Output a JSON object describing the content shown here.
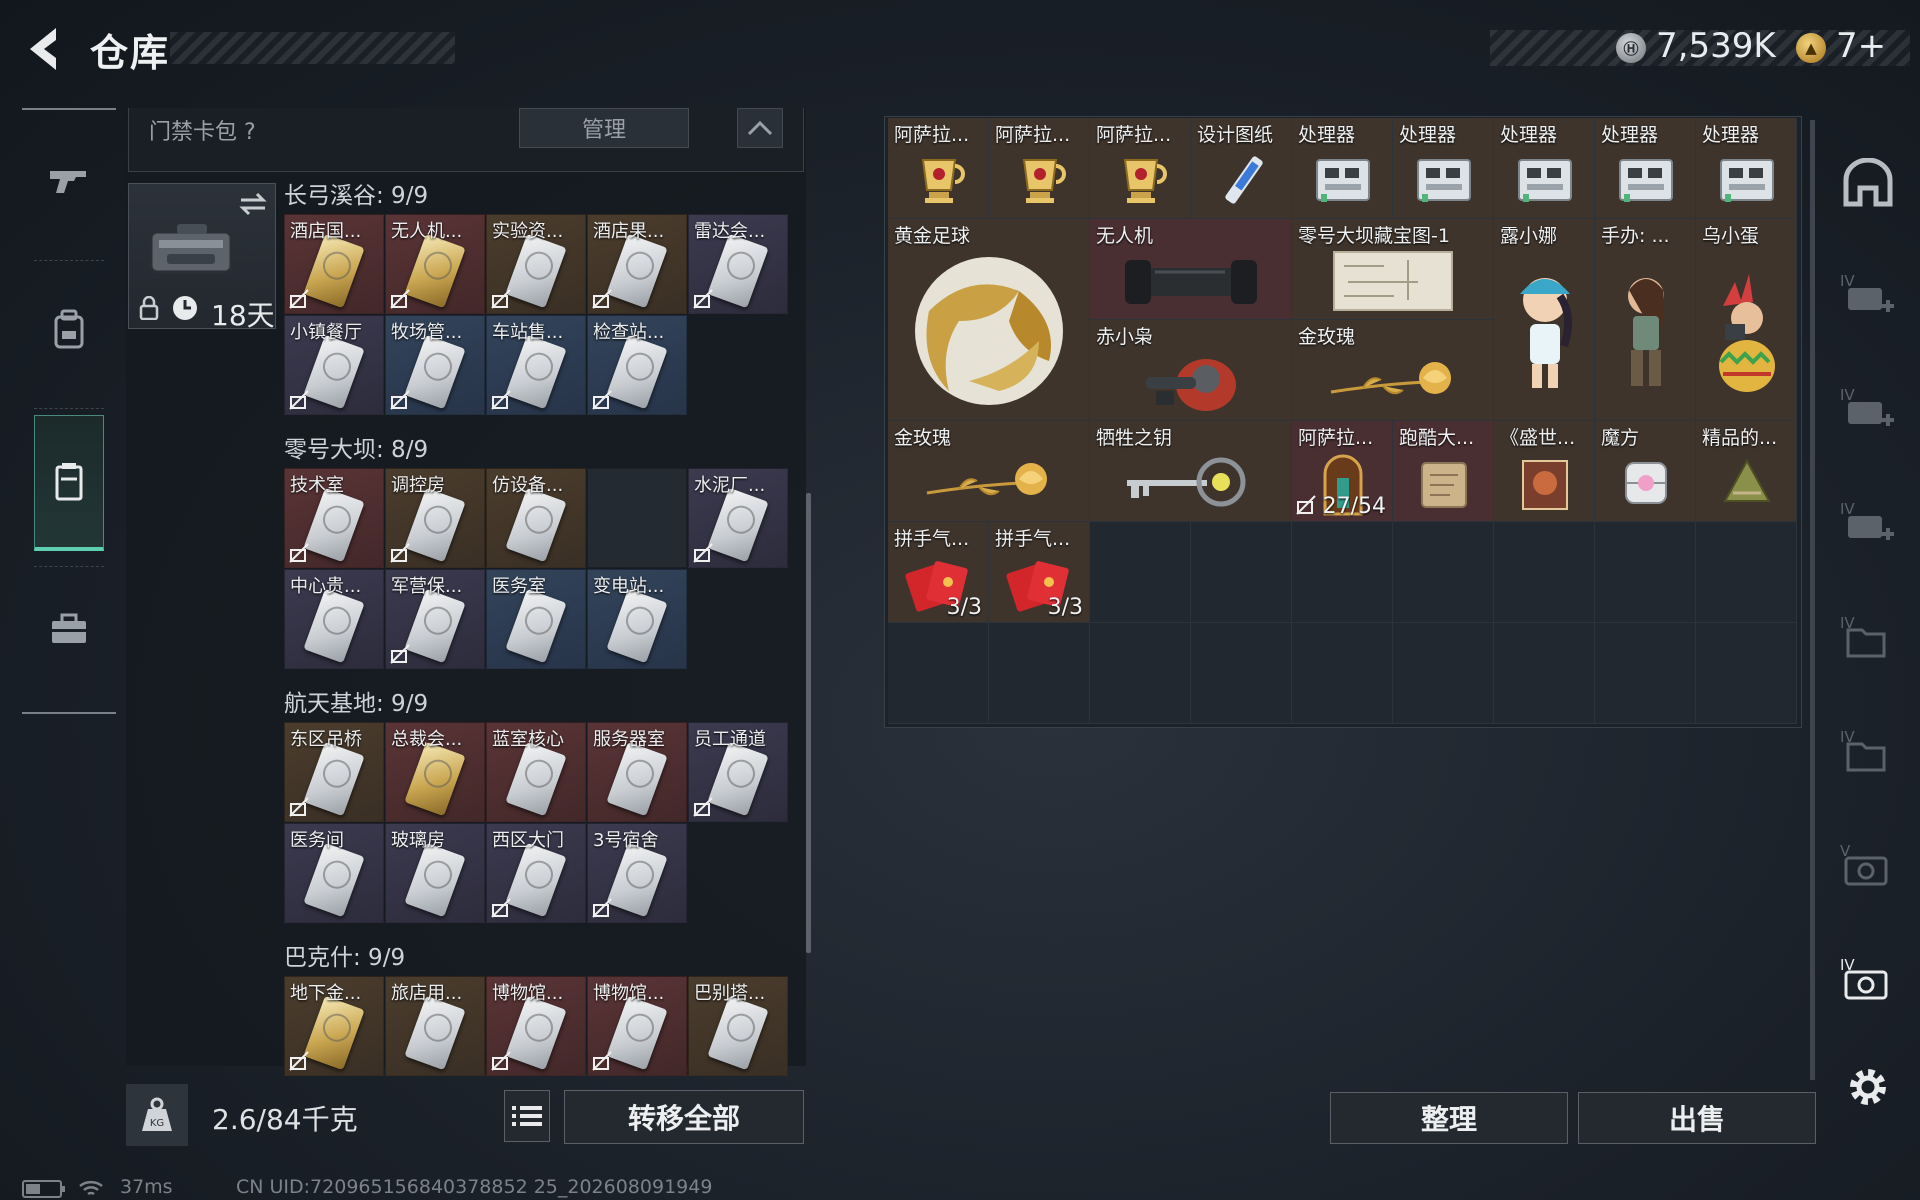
{
  "header": {
    "title": "仓库"
  },
  "currency": {
    "silver": "7,539K",
    "gold": "7+"
  },
  "card_panel": {
    "title": "门禁卡包",
    "help": "?",
    "manage": "管理",
    "pack_duration": "18天",
    "sections": [
      {
        "title": "长弓溪谷: 9/9",
        "cells": [
          {
            "label": "酒店国...",
            "color": "red",
            "card": "gold",
            "locked": true
          },
          {
            "label": "无人机...",
            "color": "red",
            "card": "gold",
            "locked": true
          },
          {
            "label": "实验资...",
            "color": "gold",
            "card": "white",
            "locked": true
          },
          {
            "label": "酒店果...",
            "color": "gold",
            "card": "white",
            "locked": true
          },
          {
            "label": "雷达会...",
            "color": "purple",
            "card": "white",
            "locked": true
          },
          {
            "label": "小镇餐厅",
            "color": "purple",
            "card": "white",
            "locked": true
          },
          {
            "label": "牧场管...",
            "color": "blue",
            "card": "white",
            "locked": true
          },
          {
            "label": "车站售...",
            "color": "blue",
            "card": "white",
            "locked": true
          },
          {
            "label": "检查站...",
            "color": "blue",
            "card": "white",
            "locked": true
          }
        ]
      },
      {
        "title": "零号大坝: 8/9",
        "cells": [
          {
            "label": "技术室",
            "color": "red",
            "card": "white",
            "locked": true
          },
          {
            "label": "调控房",
            "color": "gold",
            "card": "white",
            "locked": true
          },
          {
            "label": "仿设备...",
            "color": "gold",
            "card": "white",
            "locked": false
          },
          {
            "label": "",
            "color": "empty",
            "card": "none",
            "locked": false
          },
          {
            "label": "水泥厂...",
            "color": "purple",
            "card": "white",
            "locked": true
          },
          {
            "label": "中心贵...",
            "color": "purple",
            "card": "white",
            "locked": false
          },
          {
            "label": "军营保...",
            "color": "purple",
            "card": "white",
            "locked": true
          },
          {
            "label": "医务室",
            "color": "blue",
            "card": "white",
            "locked": false
          },
          {
            "label": "变电站...",
            "color": "blue",
            "card": "white",
            "locked": false
          }
        ]
      },
      {
        "title": "航天基地: 9/9",
        "cells": [
          {
            "label": "东区吊桥",
            "color": "gold",
            "card": "white",
            "locked": true
          },
          {
            "label": "总裁会...",
            "color": "red",
            "card": "gold",
            "locked": false
          },
          {
            "label": "蓝室核心",
            "color": "red",
            "card": "white",
            "locked": false
          },
          {
            "label": "服务器室",
            "color": "red",
            "card": "white",
            "locked": false
          },
          {
            "label": "员工通道",
            "color": "purple",
            "card": "white",
            "locked": true
          },
          {
            "label": "医务间",
            "color": "purple",
            "card": "white",
            "locked": false
          },
          {
            "label": "玻璃房",
            "color": "purple",
            "card": "white",
            "locked": false
          },
          {
            "label": "西区大门",
            "color": "purple",
            "card": "white",
            "locked": true
          },
          {
            "label": "3号宿舍",
            "color": "purple",
            "card": "white",
            "locked": true
          }
        ]
      },
      {
        "title": "巴克什: 9/9",
        "cells": [
          {
            "label": "地下金...",
            "color": "gold",
            "card": "gold",
            "locked": true
          },
          {
            "label": "旅店用...",
            "color": "gold",
            "card": "white",
            "locked": false
          },
          {
            "label": "博物馆...",
            "color": "red",
            "card": "white",
            "locked": true
          },
          {
            "label": "博物馆...",
            "color": "red",
            "card": "white",
            "locked": true
          },
          {
            "label": "巴别塔...",
            "color": "gold",
            "card": "white",
            "locked": false
          }
        ]
      }
    ]
  },
  "bottom_left": {
    "weight": "2.6/84千克",
    "weight_unit_icon": "KG",
    "transfer_all": "转移全部"
  },
  "warehouse": {
    "items": [
      {
        "label": "阿萨拉...",
        "bg": "gold",
        "icon": "cup",
        "col": 1,
        "row": 1,
        "w": 1,
        "h": 1
      },
      {
        "label": "阿萨拉...",
        "bg": "gold",
        "icon": "cup",
        "col": 2,
        "row": 1,
        "w": 1,
        "h": 1
      },
      {
        "label": "阿萨拉...",
        "bg": "gold",
        "icon": "cup",
        "col": 3,
        "row": 1,
        "w": 1,
        "h": 1
      },
      {
        "label": "设计图纸",
        "bg": "gold",
        "icon": "blueprint",
        "col": 4,
        "row": 1,
        "w": 1,
        "h": 1
      },
      {
        "label": "处理器",
        "bg": "gold",
        "icon": "processor",
        "col": 5,
        "row": 1,
        "w": 1,
        "h": 1
      },
      {
        "label": "处理器",
        "bg": "gold",
        "icon": "processor",
        "col": 6,
        "row": 1,
        "w": 1,
        "h": 1
      },
      {
        "label": "处理器",
        "bg": "gold",
        "icon": "processor",
        "col": 7,
        "row": 1,
        "w": 1,
        "h": 1
      },
      {
        "label": "处理器",
        "bg": "gold",
        "icon": "processor",
        "col": 8,
        "row": 1,
        "w": 1,
        "h": 1
      },
      {
        "label": "处理器",
        "bg": "gold",
        "icon": "processor",
        "col": 9,
        "row": 1,
        "w": 1,
        "h": 1
      },
      {
        "label": "黄金足球",
        "bg": "gold",
        "icon": "golden-ball",
        "col": 1,
        "row": 2,
        "w": 2,
        "h": 2
      },
      {
        "label": "无人机",
        "bg": "red",
        "icon": "drone",
        "col": 3,
        "row": 2,
        "w": 2,
        "h": 1
      },
      {
        "label": "零号大坝藏宝图-1",
        "bg": "gold",
        "icon": "treasure-map",
        "col": 5,
        "row": 2,
        "w": 2,
        "h": 1
      },
      {
        "label": "露小娜",
        "bg": "gold",
        "icon": "figurine-girl",
        "col": 7,
        "row": 2,
        "w": 1,
        "h": 2
      },
      {
        "label": "手办: ...",
        "bg": "gold",
        "icon": "figurine-adventurer",
        "col": 8,
        "row": 2,
        "w": 1,
        "h": 2
      },
      {
        "label": "乌小蛋",
        "bg": "gold",
        "icon": "figurine-egg",
        "col": 9,
        "row": 2,
        "w": 1,
        "h": 2
      },
      {
        "label": "赤小枭",
        "bg": "gold",
        "icon": "figurine-owl",
        "col": 3,
        "row": 3,
        "w": 2,
        "h": 1
      },
      {
        "label": "金玫瑰",
        "bg": "gold",
        "icon": "golden-rose",
        "col": 5,
        "row": 3,
        "w": 2,
        "h": 1
      },
      {
        "label": "金玫瑰",
        "bg": "gold",
        "icon": "golden-rose",
        "col": 1,
        "row": 4,
        "w": 2,
        "h": 1
      },
      {
        "label": "牺牲之钥",
        "bg": "gold",
        "icon": "key",
        "col": 3,
        "row": 4,
        "w": 2,
        "h": 1
      },
      {
        "label": "阿萨拉...",
        "bg": "red",
        "icon": "relic",
        "col": 5,
        "row": 4,
        "w": 1,
        "h": 1,
        "count": "27/54",
        "locked": true
      },
      {
        "label": "跑酷大...",
        "bg": "red",
        "icon": "scroll",
        "col": 6,
        "row": 4,
        "w": 1,
        "h": 1
      },
      {
        "label": "《盛世...",
        "bg": "gold",
        "icon": "book",
        "col": 7,
        "row": 4,
        "w": 1,
        "h": 1
      },
      {
        "label": "魔方",
        "bg": "gold",
        "icon": "cube",
        "col": 8,
        "row": 4,
        "w": 1,
        "h": 1
      },
      {
        "label": "精品的...",
        "bg": "gold",
        "icon": "zongzi",
        "col": 9,
        "row": 4,
        "w": 1,
        "h": 1
      },
      {
        "label": "拼手气...",
        "bg": "gold",
        "icon": "red-envelope",
        "col": 1,
        "row": 5,
        "w": 1,
        "h": 1,
        "count": "3/3"
      },
      {
        "label": "拼手气...",
        "bg": "gold",
        "icon": "red-envelope",
        "col": 2,
        "row": 5,
        "w": 1,
        "h": 1,
        "count": "3/3"
      }
    ]
  },
  "bottom_right": {
    "sort": "整理",
    "sell": "出售"
  },
  "right_nav": {
    "labels": [
      "IV",
      "IV",
      "IV",
      "IV",
      "IV",
      "V",
      "IV"
    ]
  },
  "status": {
    "ping": "37ms",
    "uid": "CN UID:720965156840378852 25_202608091949"
  },
  "colors": {
    "accent": "#5fcfb1",
    "gold_bg": "#3e342c",
    "red_bg": "#4a2f32"
  }
}
